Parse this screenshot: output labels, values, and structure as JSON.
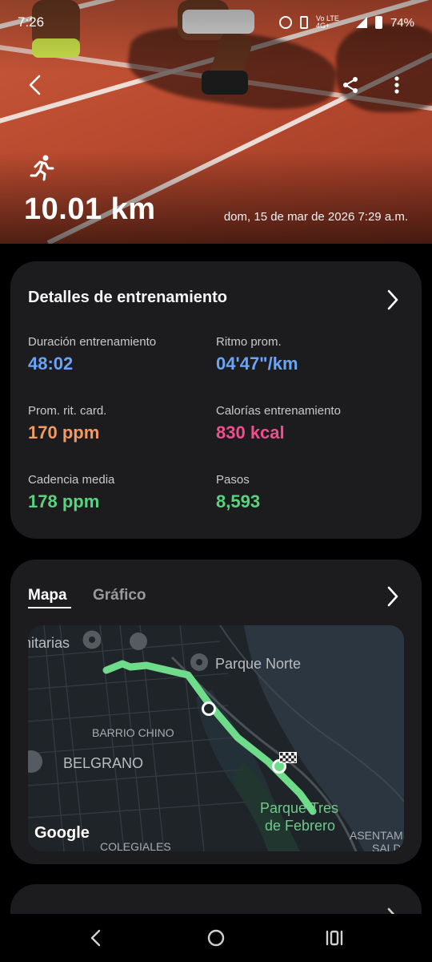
{
  "status_bar": {
    "time": "7:26",
    "network_label": "Vo LTE 4G+",
    "battery": "74%"
  },
  "header": {
    "distance": "10.01 km",
    "datetime": "dom, 15 de mar de 2026 7:29 a.m.",
    "icons": [
      "back-arrow-icon",
      "share-icon",
      "more-options-icon",
      "running-icon"
    ]
  },
  "details": {
    "title": "Detalles de entrenamiento",
    "metrics": [
      {
        "label": "Duración entrenamiento",
        "value": "48:02",
        "color": "#6aa4f5"
      },
      {
        "label": "Ritmo prom.",
        "value": "04'47\"/km",
        "color": "#6aa4f5"
      },
      {
        "label": "Prom. rit. card.",
        "value": "170 ppm",
        "color": "#f39a62"
      },
      {
        "label": "Calorías entrenamiento",
        "value": "830 kcal",
        "color": "#ee4f8e"
      },
      {
        "label": "Cadencia media",
        "value": "178 ppm",
        "color": "#59d47e"
      },
      {
        "label": "Pasos",
        "value": "8,593",
        "color": "#59d47e"
      }
    ]
  },
  "map_card": {
    "tabs": [
      {
        "label": "Mapa",
        "active": true
      },
      {
        "label": "Gráfico",
        "active": false
      }
    ],
    "map_labels": {
      "unitarias": "nitarias",
      "parque_norte": "Parque Norte",
      "barrio_chino": "BARRIO CHINO",
      "belgrano": "BELGRANO",
      "parque_tres": "Parque Tres",
      "de_febrero": "de Febrero",
      "colegiales": "COLEGIALES",
      "asentamiento": "ASENTAMI",
      "saldias": "SALDÍ"
    },
    "attribution": "Google",
    "route_color": "#6fdc8c"
  },
  "nav_bar": {
    "icons": [
      "nav-back-icon",
      "nav-home-icon",
      "nav-recents-icon"
    ]
  }
}
